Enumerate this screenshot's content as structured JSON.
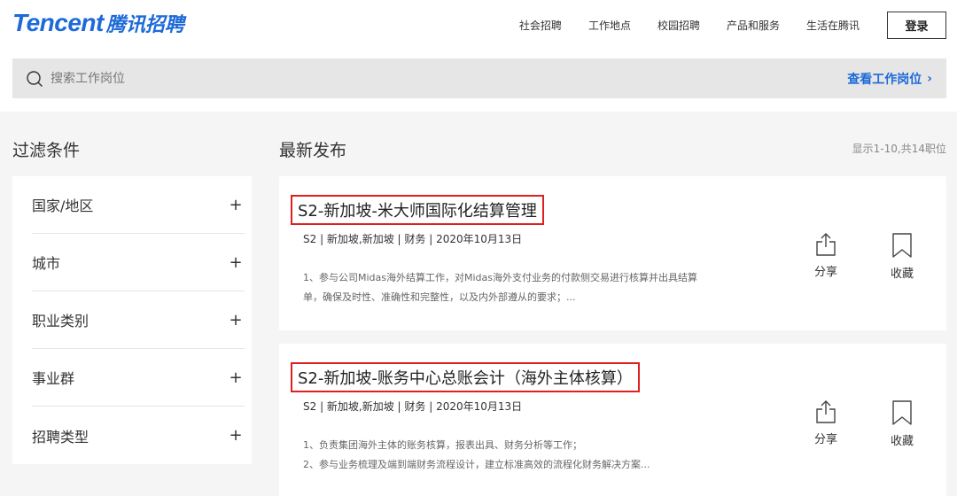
{
  "header": {
    "logo_en": "Tencent",
    "logo_cn": "腾讯招聘",
    "nav": [
      "社会招聘",
      "工作地点",
      "校园招聘",
      "产品和服务",
      "生活在腾讯"
    ],
    "login_label": "登录"
  },
  "search": {
    "placeholder": "搜索工作岗位",
    "link_label": "查看工作岗位",
    "link_arrow": "›"
  },
  "filters": {
    "title": "过滤条件",
    "items": [
      "国家/地区",
      "城市",
      "职业类别",
      "事业群",
      "招聘类型"
    ],
    "expand_glyph": "+"
  },
  "listing": {
    "title": "最新发布",
    "count_text": "显示1-10,共14职位"
  },
  "jobs": [
    {
      "title": "S2-新加坡-米大师国际化结算管理",
      "meta": "S2 | 新加坡,新加坡 | 财务 | 2020年10月13日",
      "desc_line1": "1、参与公司Midas海外结算工作，对Midas海外支付业务的付款侧交易进行核算并出具结算",
      "desc_line2": "单，确保及时性、准确性和完整性，以及内外部遵从的要求；..."
    },
    {
      "title": "S2-新加坡-账务中心总账会计（海外主体核算）",
      "meta": "S2 | 新加坡,新加坡 | 财务 | 2020年10月13日",
      "desc_line1": "1、负责集团海外主体的账务核算，报表出具、财务分析等工作；",
      "desc_line2": "2、参与业务梳理及端到端财务流程设计，建立标准高效的流程化财务解决方案..."
    }
  ],
  "actions": {
    "share_label": "分享",
    "save_label": "收藏",
    "share_icon": "share-icon",
    "save_icon": "bookmark-icon"
  },
  "colors": {
    "brand": "#1d6ad8",
    "highlight": "#e02020"
  }
}
